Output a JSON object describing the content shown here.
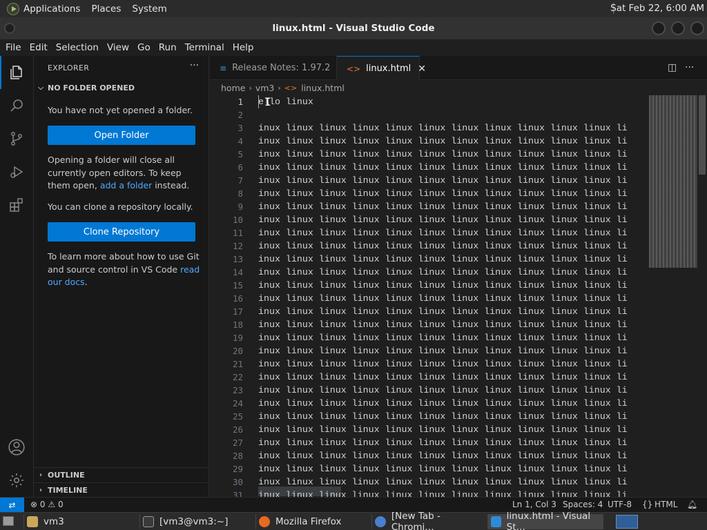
{
  "top_panel": {
    "menus": [
      "Applications",
      "Places",
      "System"
    ],
    "clock": "Sat Feb 22,  6:00 AM"
  },
  "window": {
    "title": "linux.html - Visual Studio Code"
  },
  "menubar": [
    "File",
    "Edit",
    "Selection",
    "View",
    "Go",
    "Run",
    "Terminal",
    "Help"
  ],
  "activity_bar": {
    "items": [
      "explorer-icon",
      "search-icon",
      "source-control-icon",
      "run-debug-icon",
      "extensions-icon"
    ],
    "bottom": [
      "accounts-icon",
      "manage-gear-icon"
    ]
  },
  "sidebar": {
    "title": "EXPLORER",
    "more": "···",
    "section_title": "NO FOLDER OPENED",
    "msg_no_folder": "You have not yet opened a folder.",
    "open_folder_btn": "Open Folder",
    "msg_opening_1": "Opening a folder will close all currently open editors. To keep them open, ",
    "msg_opening_link": "add a folder",
    "msg_opening_2": " instead.",
    "msg_clone": "You can clone a repository locally.",
    "clone_btn": "Clone Repository",
    "msg_learn_1": "To learn more about how to use Git and source control in VS Code ",
    "msg_learn_link": "read our docs",
    "msg_learn_2": ".",
    "outline": "OUTLINE",
    "timeline": "TIMELINE"
  },
  "tabs": [
    {
      "label": "Release Notes: 1.97.2",
      "icon": "vscode-tab-icon",
      "active": false
    },
    {
      "label": "linux.html",
      "icon": "html-tab-icon",
      "active": true,
      "close": "✕"
    }
  ],
  "breadcrumb": {
    "parts": [
      "home",
      "vm3",
      "linux.html"
    ]
  },
  "editor": {
    "line_numbers": [
      "1",
      "2",
      "3",
      "4",
      "5",
      "6",
      "7",
      "8",
      "9",
      "10",
      "11",
      "12",
      "13",
      "14",
      "15",
      "16",
      "17",
      "18",
      "19",
      "20",
      "21",
      "22",
      "23",
      "24",
      "25",
      "26",
      "27",
      "28",
      "29",
      "30",
      "31"
    ],
    "line1": "ello linux",
    "line2": "",
    "repeat_line": "inux linux linux linux linux linux linux linux linux linux linux li",
    "cursor": {
      "line": 1,
      "col": 3
    }
  },
  "statusbar": {
    "remote": "⇄",
    "errors": "0",
    "warnings": "0",
    "position": "Ln 1, Col 3",
    "spaces": "Spaces: 4",
    "encoding": "UTF-8",
    "language": "HTML",
    "language_icon": "{}"
  },
  "taskbar": {
    "items": [
      {
        "label": "vm3",
        "icon": "folder-icon"
      },
      {
        "label": "[vm3@vm3:~]",
        "icon": "terminal-icon"
      },
      {
        "label": "Mozilla Firefox",
        "icon": "firefox-icon"
      },
      {
        "label": "[New Tab - Chromi…",
        "icon": "chromium-icon"
      },
      {
        "label": "linux.html - Visual St…",
        "icon": "vscode-icon",
        "active": true
      }
    ]
  }
}
